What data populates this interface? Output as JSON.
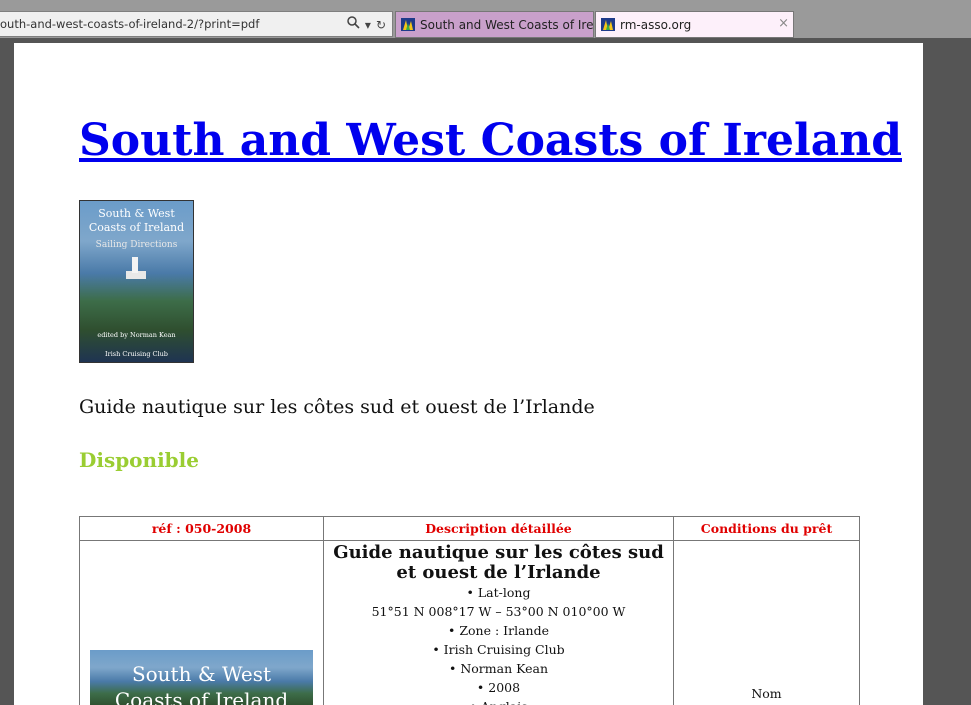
{
  "browser": {
    "address": "outh-and-west-coasts-of-ireland-2/?print=pdf",
    "search_icon": "search-icon",
    "refresh_icon": "refresh-icon",
    "tabs": [
      {
        "label": "South and West Coasts of Irela...",
        "favicon": "rm-asso-favicon"
      },
      {
        "label": "rm-asso.org",
        "favicon": "rm-asso-favicon",
        "close": "×"
      }
    ]
  },
  "page": {
    "title": "South and West Coasts of Ireland",
    "cover": {
      "line1": "South & West",
      "line2": "Coasts of Ireland",
      "line3": "Sailing Directions",
      "editor": "edited by Norman Kean",
      "publisher": "Irish Cruising Club"
    },
    "subtitle": "Guide nautique sur les côtes sud et ouest de l’Irlande",
    "status": "Disponible",
    "status_color": "#9acd32",
    "table": {
      "headers": [
        "réf : 050-2008",
        "Description détaillée",
        "Conditions du prêt"
      ],
      "header_color": "#e00000",
      "desc_title": "Guide nautique sur les côtes sud et ouest de l’Irlande",
      "desc_lines": [
        "• Lat-long",
        "51°51 N 008°17 W – 53°00 N 010°00 W",
        "• Zone : Irlande",
        "• Irish Cruising Club",
        "• Norman Kean",
        "• 2008",
        "• Anglais"
      ],
      "cover_large": {
        "line1": "South & West",
        "line2": "Coasts of Ireland"
      },
      "conditions": "Nom"
    }
  }
}
